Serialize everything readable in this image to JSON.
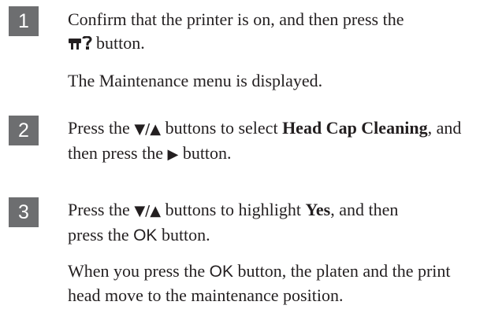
{
  "steps": [
    {
      "number": "1",
      "line1_text": "Confirm that the printer is on, and then press the",
      "line2_icon": "maintenance-icon",
      "line2_text": "button.",
      "result": "The Maintenance menu is displayed."
    },
    {
      "number": "2",
      "press": "Press the",
      "down_up": "▼/▲",
      "buttons_to_select": "buttons to select",
      "bold_item": "Head Cap Cleaning",
      "and_then_press_the": ", and then press the",
      "right_arrow": "▶",
      "button_end": "button."
    },
    {
      "number": "3",
      "press": "Press the",
      "down_up": "▼/▲",
      "buttons_to_highlight": "buttons to highlight",
      "bold_item": "Yes",
      "and_then": ", and then",
      "press_the": "press the",
      "ok_label": "OK",
      "button_end": "button.",
      "result_start": "When you press the",
      "result_ok": "OK",
      "result_end": "button, the platen and the print head move to the maintenance position."
    }
  ]
}
